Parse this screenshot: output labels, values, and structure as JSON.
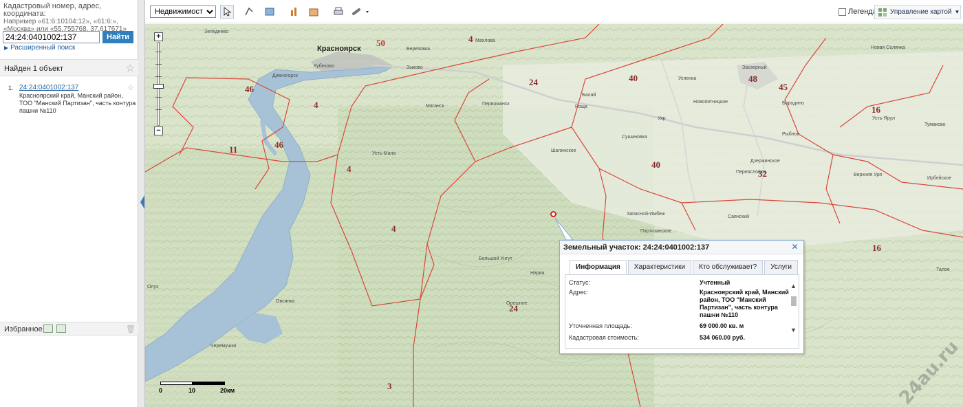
{
  "search": {
    "hint_line1": "Кадастровый номер, адрес, координата:",
    "hint_line2": "Например «61:6:10104:12», «61:6:»,",
    "hint_line3": "«Москва» или «55.755768, 37.617671»",
    "value": "24:24:0401002:137",
    "find_label": "Найти",
    "advanced_label": "Расширенный поиск"
  },
  "results": {
    "found_label": "Найден 1 объект",
    "items": [
      {
        "num": "1.",
        "link": "24:24:0401002:137",
        "desc": "Красноярский край, Манский район, ТОО \"Манский Партизан\", часть контура пашни №110"
      }
    ]
  },
  "favorites": {
    "label": "Избранное"
  },
  "toolbar": {
    "layer_select": "Недвижимость",
    "legend_label": "Легенда",
    "map_control_label": "Управление картой"
  },
  "map": {
    "towns": [
      {
        "name": "Красноярск",
        "big": true
      },
      {
        "name": "Березовка"
      },
      {
        "name": "Дивногорск"
      },
      {
        "name": "Зеледеево"
      },
      {
        "name": "Кубеково"
      },
      {
        "name": "Махлова"
      },
      {
        "name": "Зыково"
      },
      {
        "name": "Маганск"
      },
      {
        "name": "Первоманск"
      },
      {
        "name": "Шалинское"
      },
      {
        "name": "Балай"
      },
      {
        "name": "Роща"
      },
      {
        "name": "Уяр"
      },
      {
        "name": "Сушиновка"
      },
      {
        "name": "Успенка"
      },
      {
        "name": "Новопятницкое"
      },
      {
        "name": "Заозерный"
      },
      {
        "name": "Бородино"
      },
      {
        "name": "Новая Солянка"
      },
      {
        "name": "Рыбное"
      },
      {
        "name": "Дзержинское"
      },
      {
        "name": "Переясловка"
      },
      {
        "name": "Запасной-Имбеж"
      },
      {
        "name": "Партизанское"
      },
      {
        "name": "Саянский"
      },
      {
        "name": "Большой Унгут"
      },
      {
        "name": "Нарва"
      },
      {
        "name": "Орешное"
      },
      {
        "name": "Овсянка"
      },
      {
        "name": "Черемушки"
      },
      {
        "name": "Усть-Ярул"
      },
      {
        "name": "Тумаково"
      },
      {
        "name": "Ирбейское"
      },
      {
        "name": "Верхняя Уря"
      },
      {
        "name": "Талое"
      },
      {
        "name": "Олух"
      },
      {
        "name": "Усть-Мана"
      }
    ],
    "districts": [
      "50",
      "4",
      "46",
      "4",
      "11",
      "46",
      "4",
      "4",
      "24",
      "40",
      "40",
      "48",
      "45",
      "16",
      "32",
      "24",
      "16",
      "3"
    ],
    "scale": {
      "zero": "0",
      "mid": "10",
      "end": "20км"
    }
  },
  "popup": {
    "title": "Земельный участок: 24:24:0401002:137",
    "tabs": [
      "Информация",
      "Характеристики",
      "Кто обслуживает?",
      "Услуги"
    ],
    "rows": [
      {
        "key": "Статус:",
        "value": "Учтенный"
      },
      {
        "key": "Адрес:",
        "value": "Красноярский край, Манский район, ТОО \"Манский Партизан\", часть контура пашни №110"
      },
      {
        "key": "Уточненная площадь:",
        "value": "69 000.00 кв. м"
      },
      {
        "key": "Кадастровая стоимость:",
        "value": "534 060.00 руб."
      }
    ]
  },
  "watermark": "24au.ru"
}
